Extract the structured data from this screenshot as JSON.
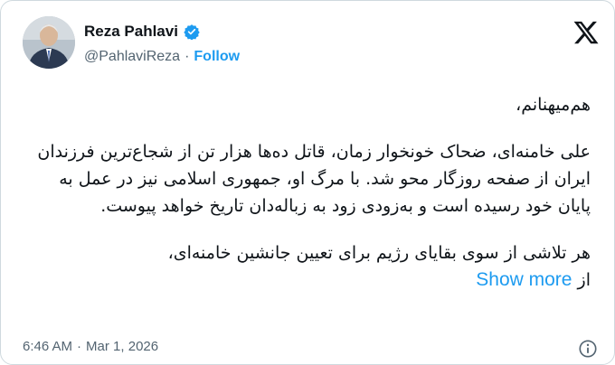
{
  "author": {
    "name": "Reza Pahlavi",
    "handle": "@PahlaviReza",
    "separator": "·",
    "follow_label": "Follow",
    "verified_color": "#1d9bf0"
  },
  "tweet": {
    "greeting": "هم‌میهنانم،",
    "paragraph1": "علی خامنه‌ای، ضحاک خونخوار زمان، قاتل ده‌ها هزار تن از شجاع‌ترین فرزندان ایران از صفحه روزگار محو شد. با مرگ او، جمهوری اسلامی نیز در عمل به پایان خود رسیده است و به‌زودی زود به زباله‌دان تاریخ خواهد پیوست.",
    "paragraph2": "هر تلاشی از سوی بقایای رژیم برای تعیین جانشین خامنه‌ای،",
    "paragraph2_tail": "از",
    "show_more_label": "Show more"
  },
  "footer": {
    "time": "6:46 AM",
    "separator": "·",
    "date": "Mar 1, 2026"
  },
  "icons": {
    "brand": "x-logo-icon",
    "verified": "verified-badge-icon",
    "info": "info-icon"
  },
  "colors": {
    "accent": "#1d9bf0",
    "text": "#0f1419",
    "muted": "#536471",
    "border": "#cfd9de"
  }
}
